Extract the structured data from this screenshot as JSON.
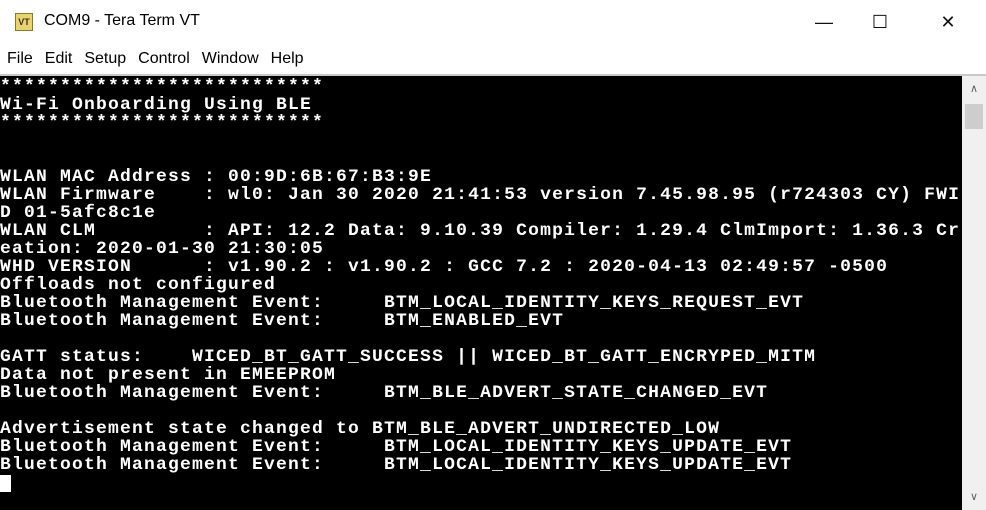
{
  "window": {
    "title": "COM9 - Tera Term VT",
    "icon_label": "VT",
    "minimize": "—",
    "maximize": "☐",
    "close": "✕"
  },
  "menu": [
    "File",
    "Edit",
    "Setup",
    "Control",
    "Window",
    "Help"
  ],
  "terminal": {
    "lines": [
      "***************************",
      "Wi-Fi Onboarding Using BLE",
      "***************************",
      "",
      "",
      "WLAN MAC Address : 00:9D:6B:67:B3:9E",
      "WLAN Firmware    : wl0: Jan 30 2020 21:41:53 version 7.45.98.95 (r724303 CY) FWI",
      "D 01-5afc8c1e",
      "WLAN CLM         : API: 12.2 Data: 9.10.39 Compiler: 1.29.4 ClmImport: 1.36.3 Cr",
      "eation: 2020-01-30 21:30:05",
      "WHD VERSION      : v1.90.2 : v1.90.2 : GCC 7.2 : 2020-04-13 02:49:57 -0500",
      "Offloads not configured",
      "Bluetooth Management Event:     BTM_LOCAL_IDENTITY_KEYS_REQUEST_EVT",
      "Bluetooth Management Event:     BTM_ENABLED_EVT",
      "",
      "GATT status:    WICED_BT_GATT_SUCCESS || WICED_BT_GATT_ENCRYPED_MITM",
      "Data not present in EMEEPROM",
      "Bluetooth Management Event:     BTM_BLE_ADVERT_STATE_CHANGED_EVT",
      "",
      "Advertisement state changed to BTM_BLE_ADVERT_UNDIRECTED_LOW",
      "Bluetooth Management Event:     BTM_LOCAL_IDENTITY_KEYS_UPDATE_EVT",
      "Bluetooth Management Event:     BTM_LOCAL_IDENTITY_KEYS_UPDATE_EVT"
    ]
  },
  "scrollbar": {
    "up": "∧",
    "down": "∨"
  }
}
